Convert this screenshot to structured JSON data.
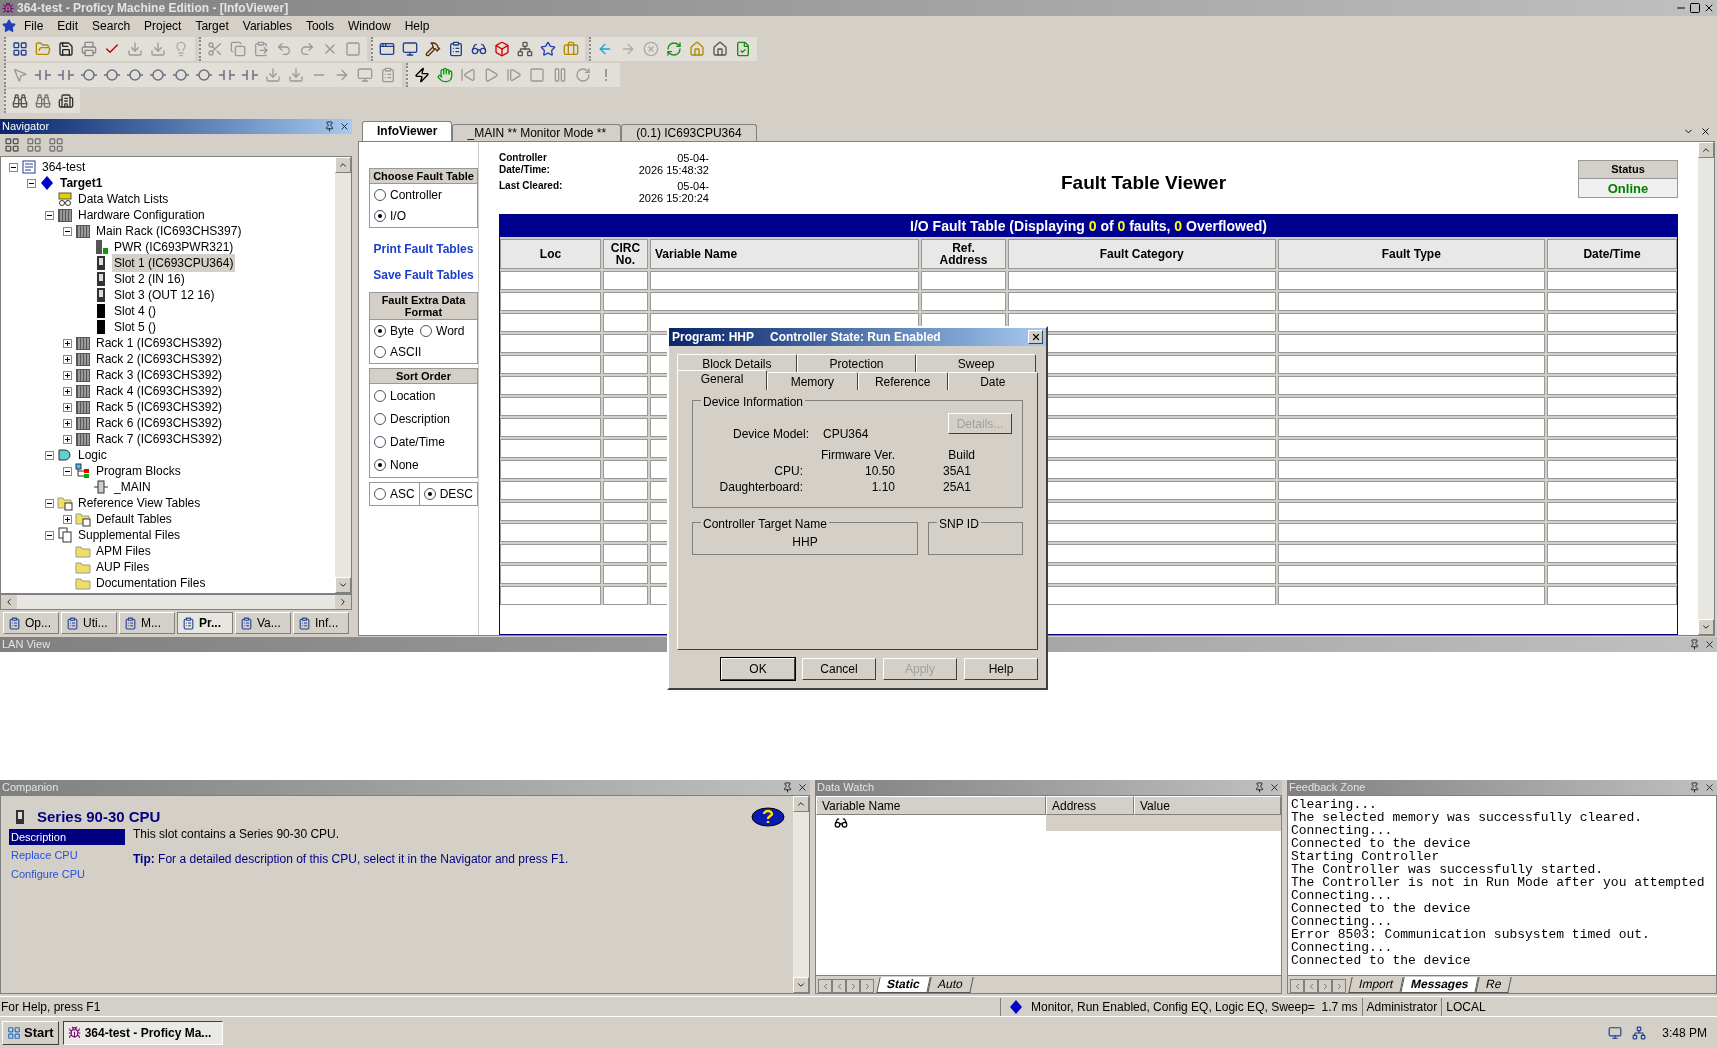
{
  "window": {
    "title": "364-test - Proficy Machine Edition - [InfoViewer]"
  },
  "menu": [
    "File",
    "Edit",
    "Search",
    "Project",
    "Target",
    "Variables",
    "Tools",
    "Window",
    "Help"
  ],
  "navigator": {
    "title": "Navigator",
    "tree": [
      {
        "label": "364-test",
        "kind": "project",
        "expanded": true,
        "selected": false,
        "children": [
          {
            "label": "Target1",
            "kind": "target",
            "expanded": true,
            "selected": false,
            "children": [
              {
                "label": "Data Watch Lists",
                "kind": "watch",
                "selected": false
              },
              {
                "label": "Hardware Configuration",
                "kind": "rack",
                "expanded": true,
                "selected": false,
                "children": [
                  {
                    "label": "Main Rack (IC693CHS397)",
                    "kind": "rack",
                    "expanded": true,
                    "selected": false,
                    "children": [
                      {
                        "label": "PWR (IC693PWR321)",
                        "kind": "power",
                        "selected": false
                      },
                      {
                        "label": "Slot 1 (IC693CPU364)",
                        "kind": "slot",
                        "selected": true
                      },
                      {
                        "label": "Slot 2 (IN 16)",
                        "kind": "slot",
                        "selected": false
                      },
                      {
                        "label": "Slot 3 (OUT 12 16)",
                        "kind": "slot",
                        "selected": false
                      },
                      {
                        "label": "Slot 4 ()",
                        "kind": "slot-empty",
                        "selected": false
                      },
                      {
                        "label": "Slot 5 ()",
                        "kind": "slot-empty",
                        "selected": false
                      }
                    ]
                  },
                  {
                    "label": "Rack 1 (IC693CHS392)",
                    "kind": "rack",
                    "expanded": false,
                    "selected": false
                  },
                  {
                    "label": "Rack 2 (IC693CHS392)",
                    "kind": "rack",
                    "expanded": false,
                    "selected": false
                  },
                  {
                    "label": "Rack 3 (IC693CHS392)",
                    "kind": "rack",
                    "expanded": false,
                    "selected": false
                  },
                  {
                    "label": "Rack 4 (IC693CHS392)",
                    "kind": "rack",
                    "expanded": false,
                    "selected": false
                  },
                  {
                    "label": "Rack 5 (IC693CHS392)",
                    "kind": "rack",
                    "expanded": false,
                    "selected": false
                  },
                  {
                    "label": "Rack 6 (IC693CHS392)",
                    "kind": "rack",
                    "expanded": false,
                    "selected": false
                  },
                  {
                    "label": "Rack 7 (IC693CHS392)",
                    "kind": "rack",
                    "expanded": false,
                    "selected": false
                  }
                ]
              },
              {
                "label": "Logic",
                "kind": "logic",
                "expanded": true,
                "selected": false,
                "children": [
                  {
                    "label": "Program Blocks",
                    "kind": "blocks",
                    "expanded": true,
                    "selected": false,
                    "children": [
                      {
                        "label": "_MAIN",
                        "kind": "block",
                        "selected": false
                      }
                    ]
                  }
                ]
              },
              {
                "label": "Reference View Tables",
                "kind": "tables",
                "expanded": true,
                "selected": false,
                "children": [
                  {
                    "label": "Default Tables",
                    "kind": "tables",
                    "expanded": false,
                    "selected": false
                  }
                ]
              },
              {
                "label": "Supplemental Files",
                "kind": "files",
                "expanded": true,
                "selected": false,
                "children": [
                  {
                    "label": "APM Files",
                    "kind": "folder",
                    "selected": false
                  },
                  {
                    "label": "AUP Files",
                    "kind": "folder",
                    "selected": false
                  },
                  {
                    "label": "Documentation Files",
                    "kind": "folder",
                    "selected": false
                  }
                ]
              }
            ]
          }
        ]
      }
    ],
    "tabs": [
      {
        "label": "Op...",
        "selected": false
      },
      {
        "label": "Uti...",
        "selected": false
      },
      {
        "label": "M...",
        "selected": false
      },
      {
        "label": "Pr...",
        "selected": true
      },
      {
        "label": "Va...",
        "selected": false
      },
      {
        "label": "Inf...",
        "selected": false
      }
    ]
  },
  "documents": {
    "tabs": [
      {
        "label": "InfoViewer",
        "selected": true
      },
      {
        "label": "_MAIN ** Monitor Mode **",
        "selected": false
      },
      {
        "label": "(0.1) IC693CPU364",
        "selected": false
      }
    ]
  },
  "fault_viewer": {
    "choose_table": {
      "title": "Choose Fault Table",
      "options": [
        {
          "label": "Controller",
          "selected": false
        },
        {
          "label": "I/O",
          "selected": true
        }
      ]
    },
    "links": [
      "Print Fault Tables",
      "Save Fault Tables"
    ],
    "format": {
      "title": "Fault Extra Data Format",
      "options": [
        {
          "label": "Byte",
          "selected": true
        },
        {
          "label": "Word",
          "selected": false
        },
        {
          "label": "ASCII",
          "selected": false
        }
      ]
    },
    "sort": {
      "title": "Sort Order",
      "options": [
        {
          "label": "Location",
          "selected": false
        },
        {
          "label": "Description",
          "selected": false
        },
        {
          "label": "Date/Time",
          "selected": false
        },
        {
          "label": "None",
          "selected": true
        }
      ],
      "direction": [
        {
          "label": "ASC",
          "selected": false
        },
        {
          "label": "DESC",
          "selected": true
        }
      ]
    },
    "controller_time": {
      "label_lines": [
        "Controller",
        "Date/Time:"
      ],
      "value_lines": [
        "05-04-",
        "2026 15:48:32"
      ]
    },
    "last_cleared": {
      "label_lines": [
        "Last Cleared:"
      ],
      "value_lines": [
        "05-04-",
        "2026 15:20:24"
      ]
    },
    "title": "Fault Table Viewer",
    "status": {
      "label": "Status",
      "value": "Online"
    },
    "table": {
      "title_parts": [
        {
          "text": "I/O Fault Table (Displaying ",
          "highlight": false
        },
        {
          "text": "0",
          "highlight": true
        },
        {
          "text": " of ",
          "highlight": false
        },
        {
          "text": "0",
          "highlight": true
        },
        {
          "text": " faults, ",
          "highlight": false
        },
        {
          "text": "0",
          "highlight": true
        },
        {
          "text": " Overflowed)",
          "highlight": false
        }
      ],
      "columns": [
        [
          "Loc"
        ],
        [
          "CIRC",
          "No."
        ],
        [
          "Variable Name"
        ],
        [
          "Ref.",
          "Address"
        ],
        [
          "Fault Category"
        ],
        [
          "Fault Type"
        ],
        [
          "Date/Time"
        ]
      ]
    }
  },
  "dialog": {
    "program": "Program: HHP",
    "state": "Controller State: Run Enabled",
    "tab_rows": [
      [
        {
          "label": "Block Details",
          "selected": false
        },
        {
          "label": "Protection",
          "selected": false
        },
        {
          "label": "Sweep",
          "selected": false
        }
      ],
      [
        {
          "label": "General",
          "selected": true
        },
        {
          "label": "Memory",
          "selected": false
        },
        {
          "label": "Reference",
          "selected": false
        },
        {
          "label": "Date",
          "selected": false
        }
      ]
    ],
    "device_group": "Device Information",
    "details_button": {
      "label": "Details...",
      "disabled": true
    },
    "model_label": "Device Model:",
    "model": "CPU364",
    "version_headers": [
      "Firmware Ver.",
      "Build"
    ],
    "versions": [
      {
        "label": "CPU:",
        "firmware": "10.50",
        "build": "35A1"
      },
      {
        "label": "Daughterboard:",
        "firmware": "1.10",
        "build": "25A1"
      }
    ],
    "target_group": "Controller Target Name",
    "target_name": "HHP",
    "snp_group": "SNP ID",
    "buttons": [
      {
        "label": "OK",
        "disabled": false
      },
      {
        "label": "Cancel",
        "disabled": false
      },
      {
        "label": "Apply",
        "disabled": true
      },
      {
        "label": "Help",
        "disabled": false
      }
    ]
  },
  "lan_view": {
    "title": "LAN View"
  },
  "companion": {
    "title": "Companion",
    "heading": "Series 90-30 CPU",
    "links": [
      {
        "label": "Description",
        "selected": true
      },
      {
        "label": "Replace CPU",
        "selected": false
      },
      {
        "label": "Configure CPU",
        "selected": false
      }
    ],
    "text": "This slot contains a Series 90-30 CPU.",
    "tip": "**Tip:** For a detailed description of this CPU, select it in the Navigator and press F1."
  },
  "data_watch": {
    "title": "Data Watch",
    "columns": [
      "Variable Name",
      "Address",
      "Value"
    ],
    "tabs": [
      {
        "label": "Static",
        "selected": true
      },
      {
        "label": "Auto",
        "selected": false
      }
    ]
  },
  "feedback": {
    "title": "Feedback Zone",
    "lines": [
      "Clearing...",
      "The selected memory was successfully cleared.",
      "Connecting...",
      "Connected to the device",
      "Starting Controller",
      "The Controller was successfully started.",
      "The Controller is not in Run Mode after you attempted",
      "Connecting...",
      "Connected to the device",
      "Connecting...",
      "Error 8503: Communication subsystem timed out.",
      "Connecting...",
      "Connected to the device"
    ],
    "tabs": [
      {
        "label": "Import",
        "selected": false
      },
      {
        "label": "Messages",
        "selected": true
      },
      {
        "label": "Re",
        "selected": false
      }
    ]
  },
  "status_bar": {
    "help": "For Help, press F1",
    "state": "Monitor, Run Enabled, Config EQ, Logic EQ, Sweep=  1.7 ms",
    "user": "Administrator",
    "mode": "LOCAL"
  },
  "taskbar": {
    "start": "Start",
    "tasks": [
      {
        "label": "364-test - Proficy Ma...",
        "selected": true
      }
    ],
    "clock": "3:48 PM"
  }
}
